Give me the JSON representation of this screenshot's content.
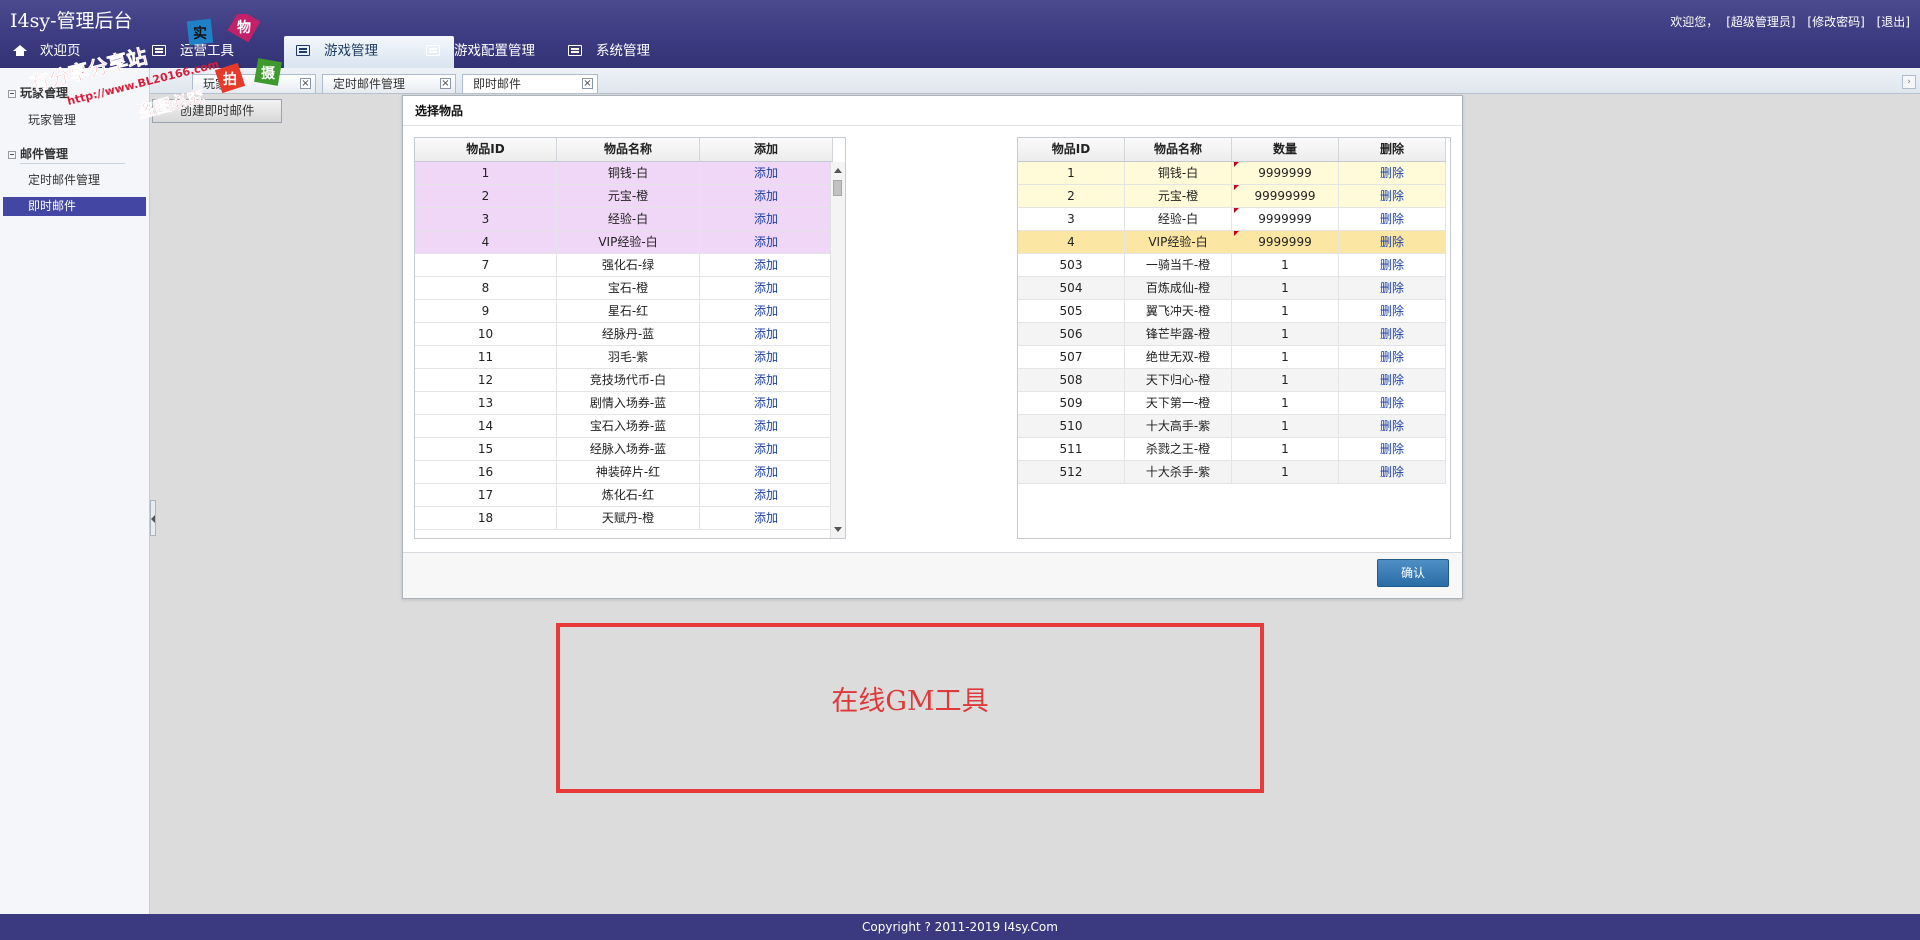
{
  "app": {
    "title": "I4sy-管理后台"
  },
  "user_links": {
    "welcome": "欢迎您，",
    "user": "[超级管理员]",
    "change_password": "[修改密码]",
    "logout": "[退出]"
  },
  "nav": [
    {
      "label": "欢迎页",
      "icon": "home-icon"
    },
    {
      "label": "运营工具",
      "icon": "list-icon"
    },
    {
      "label": "游戏管理",
      "icon": "list-icon"
    },
    {
      "label": "游戏配置管理",
      "icon": "list-icon"
    },
    {
      "label": "系统管理",
      "icon": "list-icon"
    }
  ],
  "subtabs": [
    {
      "label": "玩家"
    },
    {
      "label": "定时邮件管理"
    },
    {
      "label": "即时邮件"
    }
  ],
  "sidebar": {
    "groups": [
      {
        "label": "玩家管理",
        "items": [
          {
            "label": "玩家管理"
          }
        ]
      },
      {
        "label": "邮件管理",
        "items": [
          {
            "label": "定时邮件管理"
          },
          {
            "label": "即时邮件"
          }
        ]
      }
    ]
  },
  "toolbar": {
    "create_label": "创建即时邮件"
  },
  "dialog": {
    "title": "选择物品",
    "confirm_label": "确认",
    "left_grid": {
      "headers": [
        "物品ID",
        "物品名称",
        "添加"
      ],
      "action": "添加",
      "rows": [
        {
          "id": "1",
          "name": "铜钱-白"
        },
        {
          "id": "2",
          "name": "元宝-橙"
        },
        {
          "id": "3",
          "name": "经验-白"
        },
        {
          "id": "4",
          "name": "VIP经验-白"
        },
        {
          "id": "7",
          "name": "强化石-绿"
        },
        {
          "id": "8",
          "name": "宝石-橙"
        },
        {
          "id": "9",
          "name": "星石-红"
        },
        {
          "id": "10",
          "name": "经脉丹-蓝"
        },
        {
          "id": "11",
          "name": "羽毛-紫"
        },
        {
          "id": "12",
          "name": "竞技场代币-白"
        },
        {
          "id": "13",
          "name": "剧情入场券-蓝"
        },
        {
          "id": "14",
          "name": "宝石入场券-蓝"
        },
        {
          "id": "15",
          "name": "经脉入场券-蓝"
        },
        {
          "id": "16",
          "name": "神装碎片-红"
        },
        {
          "id": "17",
          "name": "炼化石-红"
        },
        {
          "id": "18",
          "name": "天赋丹-橙"
        }
      ]
    },
    "right_grid": {
      "headers": [
        "物品ID",
        "物品名称",
        "数量",
        "删除"
      ],
      "action": "删除",
      "rows": [
        {
          "id": "1",
          "name": "铜钱-白",
          "qty": "9999999"
        },
        {
          "id": "2",
          "name": "元宝-橙",
          "qty": "99999999"
        },
        {
          "id": "3",
          "name": "经验-白",
          "qty": "9999999"
        },
        {
          "id": "4",
          "name": "VIP经验-白",
          "qty": "9999999"
        },
        {
          "id": "503",
          "name": "一骑当千-橙",
          "qty": "1"
        },
        {
          "id": "504",
          "name": "百炼成仙-橙",
          "qty": "1"
        },
        {
          "id": "505",
          "name": "翼飞冲天-橙",
          "qty": "1"
        },
        {
          "id": "506",
          "name": "锋芒毕露-橙",
          "qty": "1"
        },
        {
          "id": "507",
          "name": "绝世无双-橙",
          "qty": "1"
        },
        {
          "id": "508",
          "name": "天下归心-橙",
          "qty": "1"
        },
        {
          "id": "509",
          "name": "天下第一-橙",
          "qty": "1"
        },
        {
          "id": "510",
          "name": "十大高手-紫",
          "qty": "1"
        },
        {
          "id": "511",
          "name": "杀戮之王-橙",
          "qty": "1"
        },
        {
          "id": "512",
          "name": "十大杀手-紫",
          "qty": "1"
        }
      ]
    }
  },
  "annotation": {
    "text": "在线GM工具"
  },
  "watermark": {
    "line1": "有分享分享站",
    "line2": "http://www.BL20166.com",
    "line3": "盗图必究",
    "seal": [
      "实",
      "物",
      "拍",
      "摄"
    ]
  },
  "footer": {
    "copyright": "Copyright ? 2011-2019 I4sy.Com"
  },
  "colors": {
    "header": "#3b3a80",
    "active_sidebar": "#4346a3",
    "selected_row": "#f1d7f7",
    "link": "#1a3fa6",
    "annotation": "#e83a3a"
  }
}
